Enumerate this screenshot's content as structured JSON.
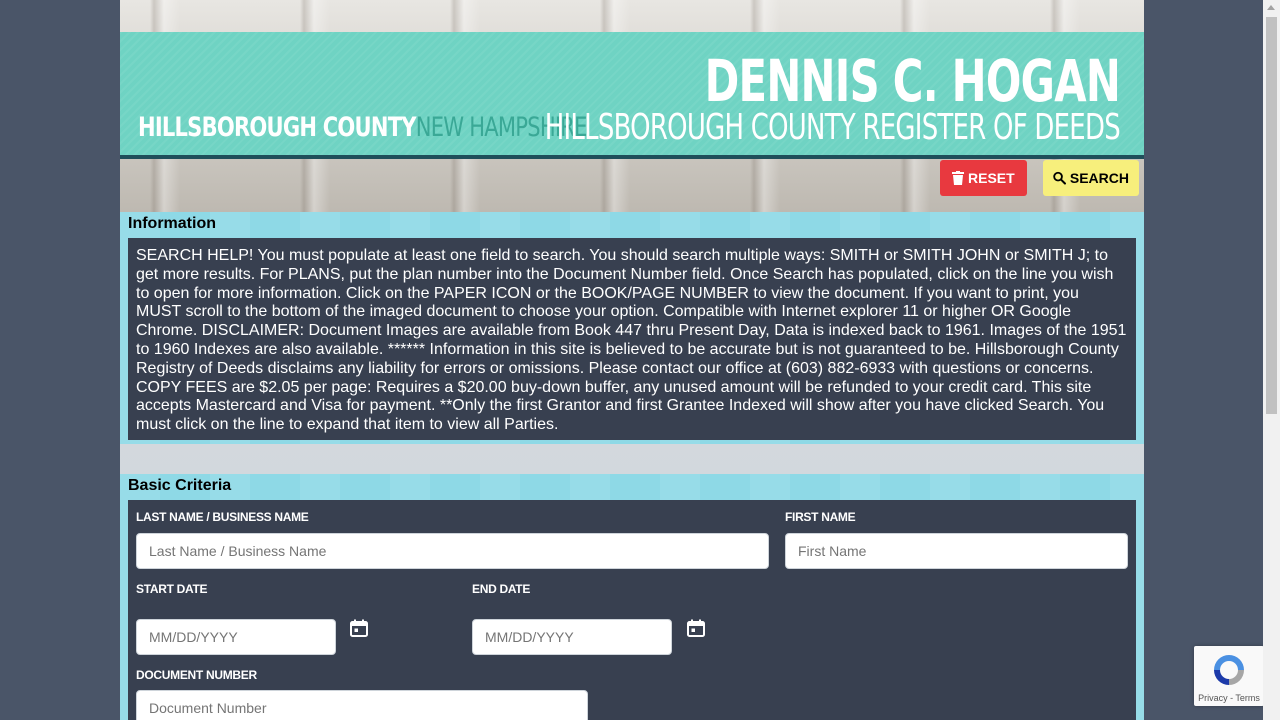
{
  "header": {
    "county_part1": "HILLSBOROUGH COUNTY",
    "county_part2": "NEW HAMPSHIRE",
    "name": "DENNIS C. HOGAN",
    "office": "HILLSBOROUGH COUNTY REGISTER OF DEEDS"
  },
  "toolbar": {
    "reset_label": "RESET",
    "search_label": "SEARCH",
    "reset_icon": "trash-icon",
    "search_icon": "search-icon"
  },
  "information": {
    "title": "Information",
    "text": "SEARCH HELP! You must populate at least one field to search. You should search multiple ways: SMITH or SMITH JOHN or SMITH J; to get more results. For PLANS, put the plan number into the Document Number field. Once Search has populated, click on the line you wish to open for more information. Click on the PAPER ICON or the BOOK/PAGE NUMBER to view the document. If you want to print, you MUST scroll to the bottom of the imaged document to choose your option. Compatible with Internet explorer 11 or higher OR Google Chrome. DISCLAIMER: Document Images are available from Book 447 thru Present Day, Data is indexed back to 1961. Images of the 1951 to 1960 Indexes are also available. ****** Information in this site is believed to be accurate but is not guaranteed to be. Hillsborough County Registry of Deeds disclaims any liability for errors or omissions. Please contact our office at (603) 882-6933 with questions or concerns. COPY FEES are $2.05 per page: Requires a $20.00 buy-down buffer, any unused amount will be refunded to your credit card. This site accepts Mastercard and Visa for payment. **Only the first Grantor and first Grantee Indexed will show after you have clicked Search. You must click on the line to expand that item to view all Parties."
  },
  "criteria": {
    "title": "Basic Criteria",
    "last_name_label": "LAST NAME / BUSINESS NAME",
    "last_name_placeholder": "Last Name / Business Name",
    "last_name_value": "",
    "first_name_label": "FIRST NAME",
    "first_name_placeholder": "First Name",
    "first_name_value": "",
    "start_date_label": "START DATE",
    "start_date_placeholder": "MM/DD/YYYY",
    "end_date_label": "END DATE",
    "end_date_placeholder": "MM/DD/YYYY",
    "document_number_label": "DOCUMENT NUMBER",
    "document_number_placeholder": "Document Number",
    "calendar_icon": "calendar-icon"
  },
  "recaptcha": {
    "terms": "Privacy - Terms"
  },
  "colors": {
    "banner": "#6fd3c3",
    "reset": "#e8393f",
    "search": "#f7ef7c",
    "panel": "#384050",
    "section": "#8ed9e6"
  }
}
